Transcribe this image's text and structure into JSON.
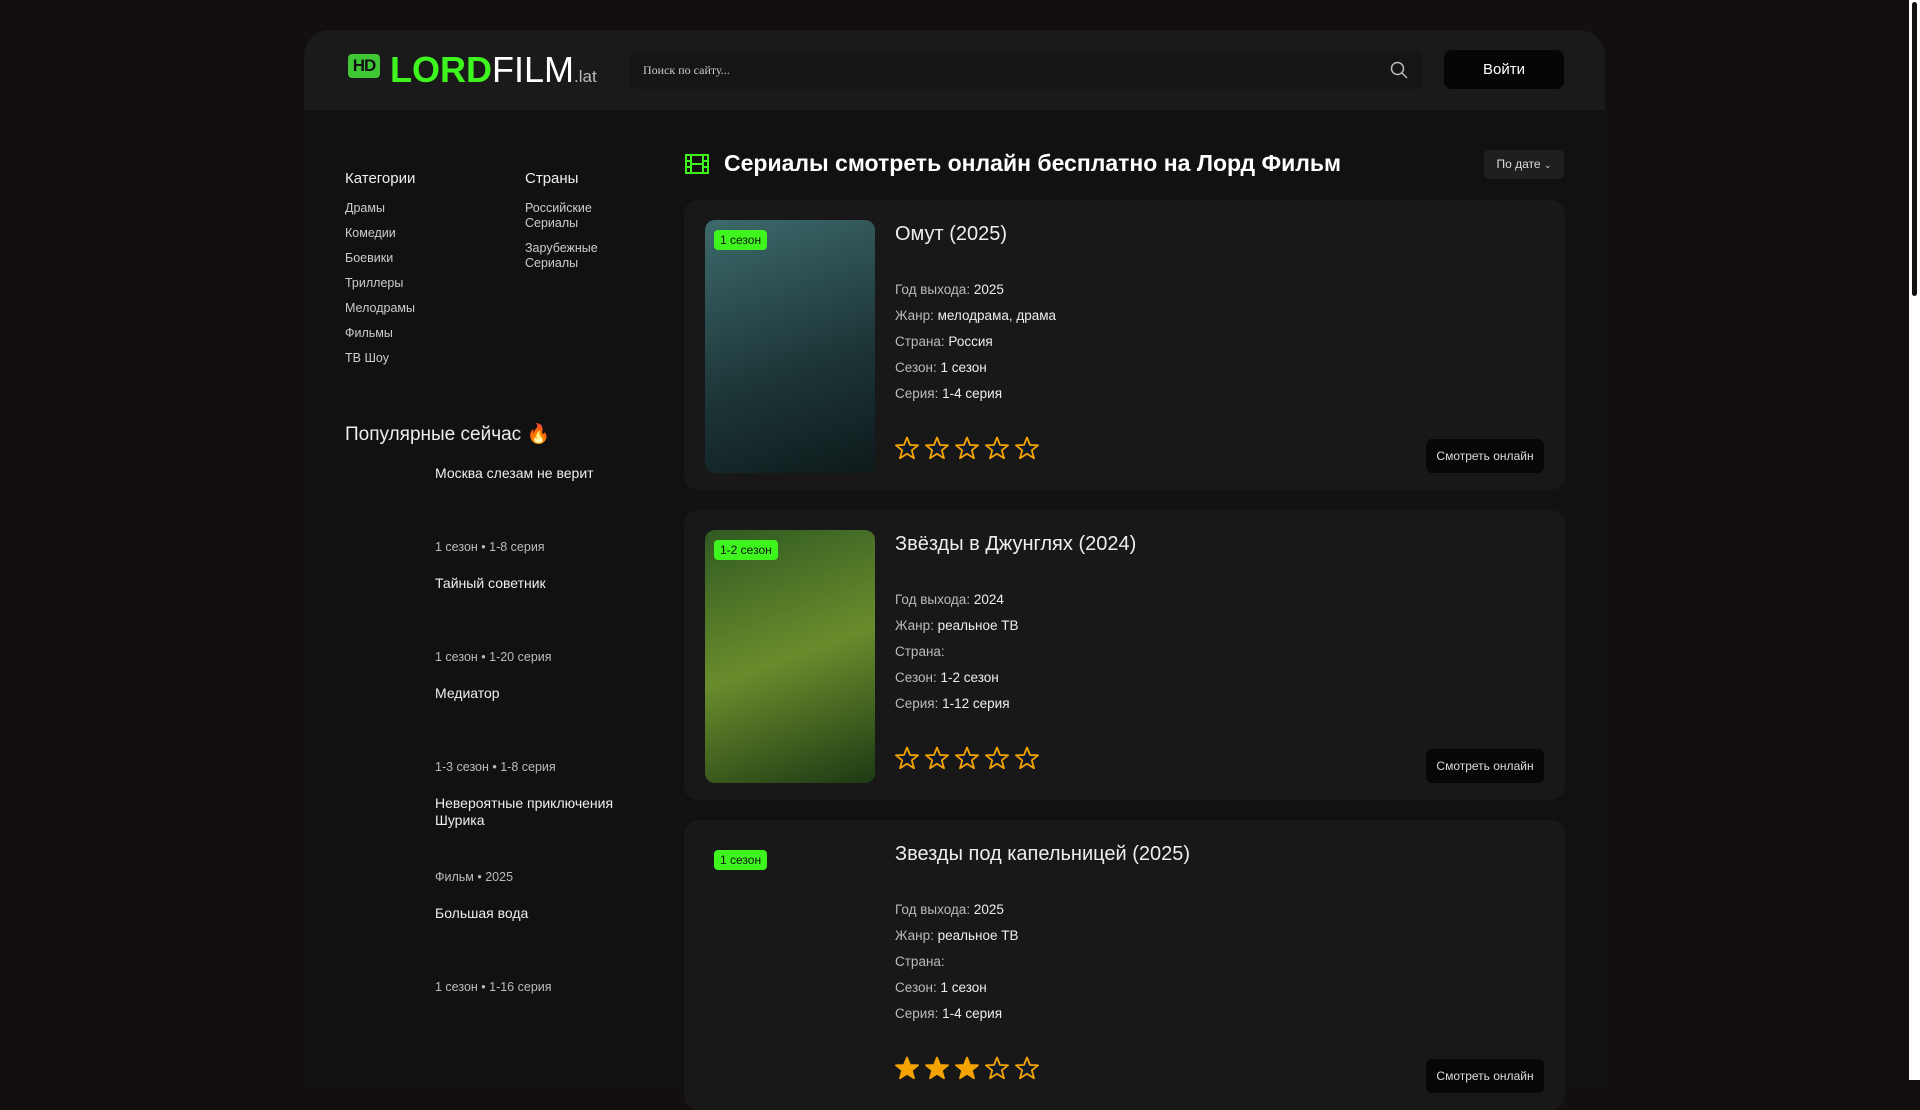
{
  "header": {
    "logo": {
      "hd": "HD",
      "lord": "LORD",
      "film": "FILM",
      "tld": ".lat"
    },
    "search_placeholder": "Поиск по сайту...",
    "login": "Войти"
  },
  "sidebar": {
    "categories_title": "Категории",
    "categories": [
      "Драмы",
      "Комедии",
      "Боевики",
      "Триллеры",
      "Мелодрамы",
      "Фильмы",
      "ТВ Шоу"
    ],
    "countries_title": "Страны",
    "countries": [
      "Российские Сериалы",
      "Зарубежные Сериалы"
    ],
    "popular_title": "Популярные сейчас 🔥",
    "popular": [
      {
        "title": "Москва слезам не верит",
        "meta": "1 сезон • 1-8 серия"
      },
      {
        "title": "Тайный советник",
        "meta": "1 сезон • 1-20 серия"
      },
      {
        "title": "Медиатор",
        "meta": "1-3 сезон • 1-8 серия"
      },
      {
        "title": "Невероятные приключения Шурика",
        "meta": "Фильм • 2025"
      },
      {
        "title": "Большая вода",
        "meta": "1 сезон • 1-16 серия"
      }
    ]
  },
  "main": {
    "title": "Сериалы смотреть онлайн бесплатно на Лорд Фильм",
    "sort": "По дате",
    "labels": {
      "year": "Год выхода: ",
      "genre": "Жанр: ",
      "country": "Страна: ",
      "season": "Сезон: ",
      "episode": "Серия: ",
      "watch": "Смотреть онлайн"
    },
    "cards": [
      {
        "badge": "1 сезон",
        "title": "Омут (2025)",
        "year": "2025",
        "genre": "мелодрама, драма",
        "country": "Россия",
        "season": "1 сезон",
        "episode": "1-4 серия",
        "rating": 0
      },
      {
        "badge": "1-2 сезон",
        "title": "Звёзды в Джунглях (2024)",
        "year": "2024",
        "genre": "реальное ТВ",
        "country": "",
        "season": "1-2 сезон",
        "episode": "1-12 серия",
        "rating": 0
      },
      {
        "badge": "1 сезон",
        "title": "Звезды под капельницей (2025)",
        "year": "2025",
        "genre": "реальное ТВ",
        "country": "",
        "season": "1 сезон",
        "episode": "1-4 серия",
        "rating": 3
      }
    ]
  },
  "colors": {
    "accent": "#3ef51e",
    "star": "#f5a300"
  }
}
